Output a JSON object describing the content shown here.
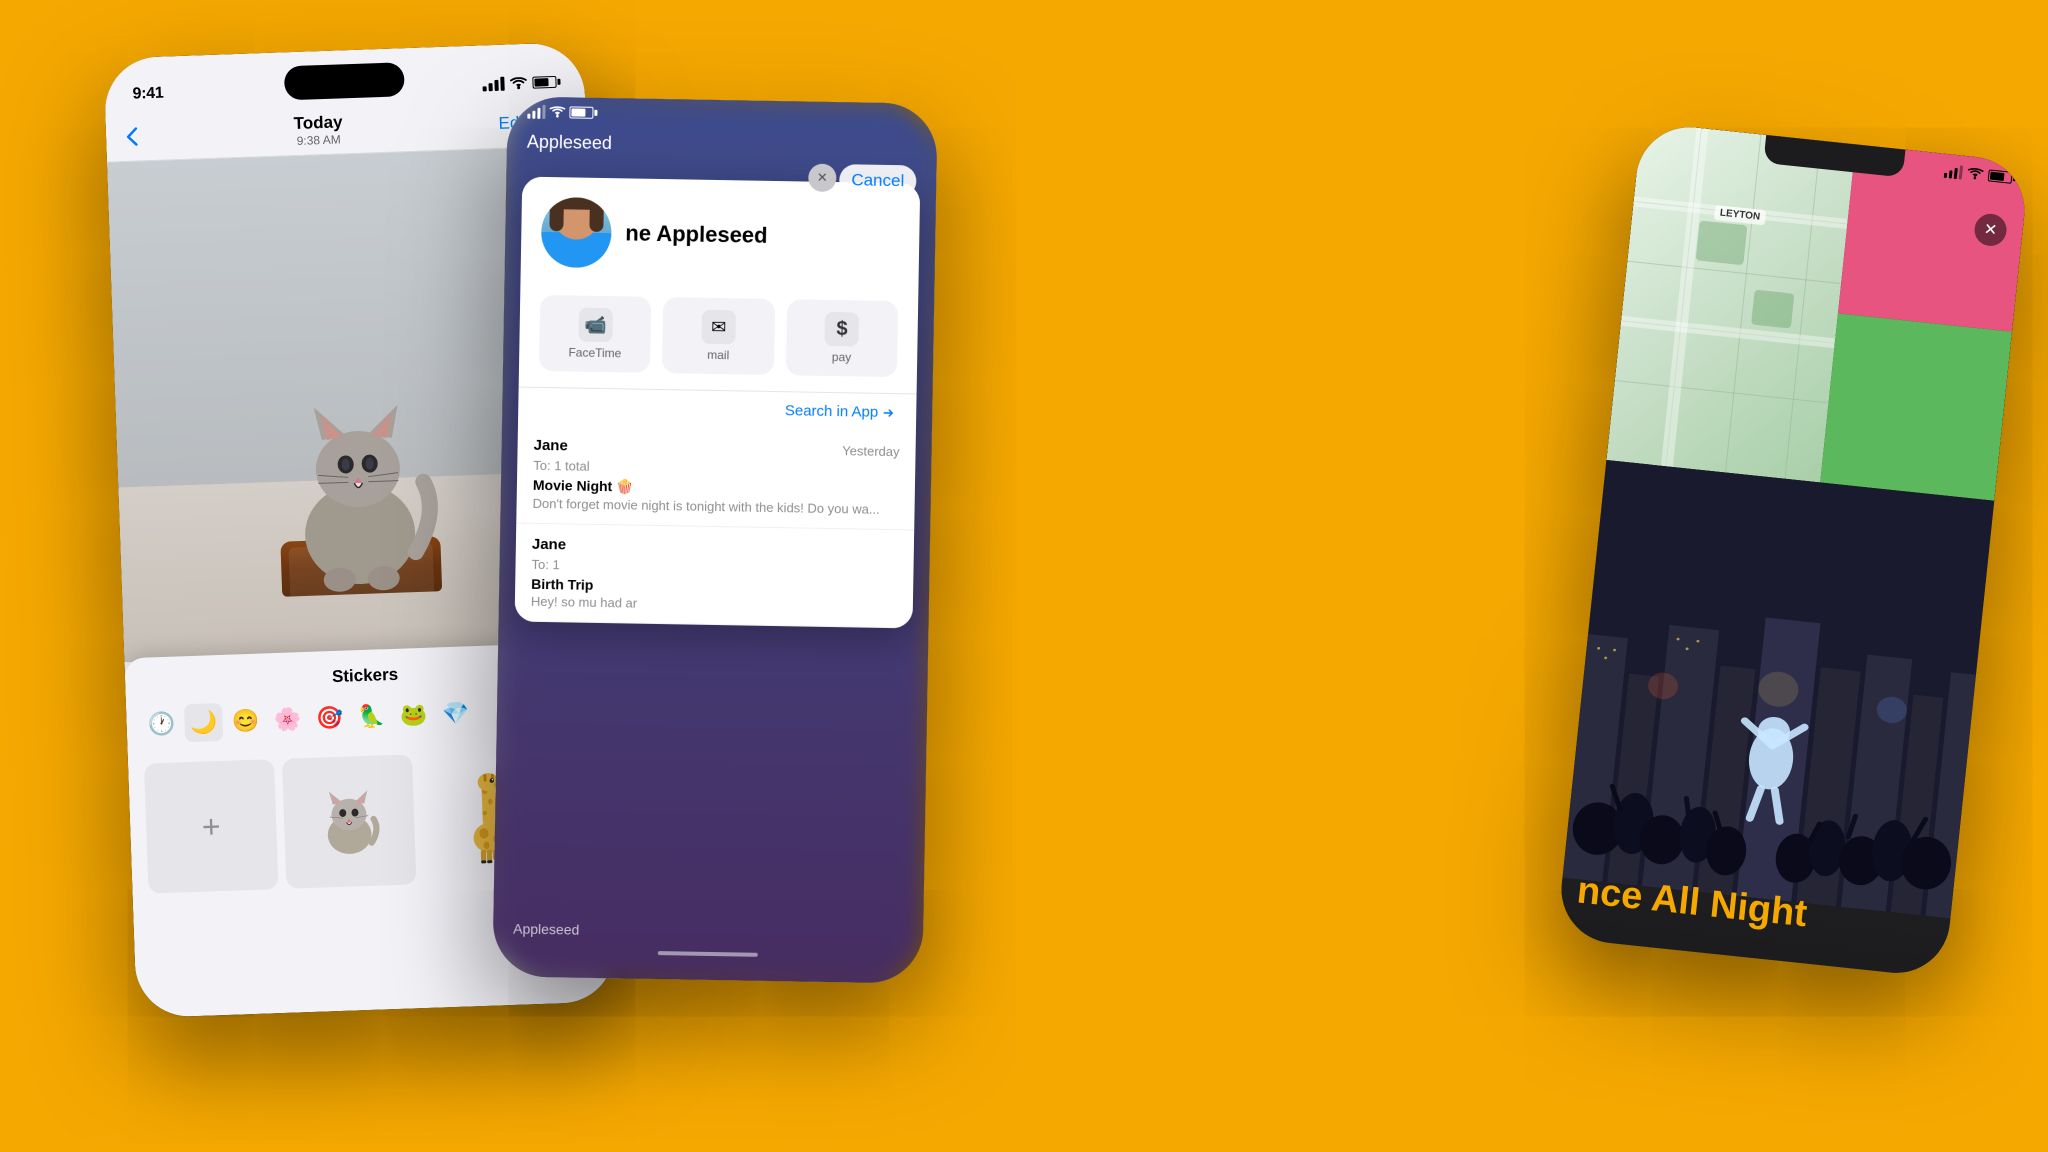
{
  "background_color": "#F5A800",
  "phone1": {
    "status_time": "9:41",
    "nav_title": "Today",
    "nav_subtitle": "9:38 AM",
    "nav_edit": "Edit",
    "back_symbol": "‹",
    "stickers_title": "Stickers",
    "stickers_close": "✕",
    "sticker_tabs": [
      "🕐",
      "🌙",
      "😊",
      "🌸",
      "🎯",
      "🦜",
      "🐸",
      "💎"
    ],
    "sticker_add_symbol": "+",
    "photo_desc": "Cat on ottoman",
    "sticker_animals": [
      "🐱",
      "🦒"
    ]
  },
  "phone2": {
    "status_signal": "●●●",
    "contact_name": "Appleseed",
    "contact_full_name": "ne Appleseed",
    "contact_dismiss": "✕",
    "cancel_text": "Cancel",
    "action_facetime": "FaceTime",
    "action_mail": "mail",
    "action_pay": "pay",
    "action_facetime_icon": "📹",
    "action_mail_icon": "✉",
    "action_pay_icon": "$",
    "search_in_app": "Search in App",
    "mail1_sender": "Jane",
    "mail1_date": "Yesterday",
    "mail1_to": "To: 1 total",
    "mail1_subject": "Movie Night 🍿",
    "mail1_preview": "Don't forget movie night is tonight with the kids! Do you wa...",
    "mail2_sender": "Jane",
    "mail2_to": "To: 1",
    "mail2_subject": "Birth Trip",
    "mail2_preview": "Hey! so mu had ar",
    "appleseed_bottom": "Appleseed"
  },
  "phone3": {
    "leyton_label": "LEYTON",
    "close_symbol": "✕",
    "dance_text": "nce All Night",
    "collage_desc": "Photo collage with map and pink/green sections"
  }
}
